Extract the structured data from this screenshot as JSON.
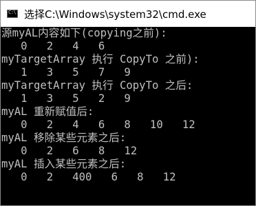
{
  "window": {
    "title": "选择C:\\Windows\\system32\\cmd.exe",
    "icon": "cmd-console-icon"
  },
  "console": {
    "foreground": "#c0c0c0",
    "background": "#000000",
    "lines": [
      "源myAL内容如下(copying之前):",
      "   0   2   4   6",
      "myTargetArray 执行 CopyTo 之前):",
      "   1   3   5   7   9",
      "myTargetArray 执行 CopyTo 之后:",
      "   1   3   5   2   9",
      "myAL 重新赋值后:",
      "   0   2   4   6   8   10   12",
      "myAL 移除某些元素之后:",
      "   0   2   6   8   12",
      "myAL 插入某些元素之后:",
      "   0   2   400   6   8   12"
    ]
  }
}
